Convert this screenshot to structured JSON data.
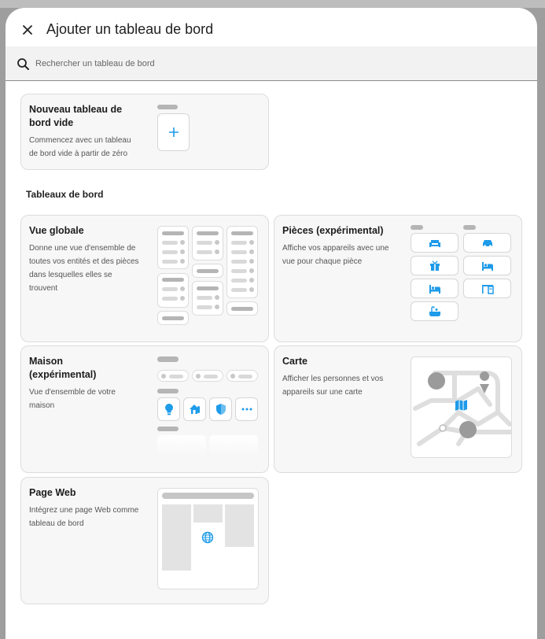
{
  "dialog": {
    "title": "Ajouter un tableau de bord",
    "close_icon": "close-icon"
  },
  "search": {
    "placeholder": "Rechercher un tableau de bord",
    "value": "",
    "icon": "search-icon"
  },
  "new_dashboard": {
    "title": "Nouveau tableau de bord vide",
    "description": "Commencez avec un tableau de bord vide à partir de zéro",
    "icon": "plus-icon"
  },
  "section": {
    "title": "Tableaux de bord"
  },
  "cards": {
    "overview": {
      "title": "Vue globale",
      "description": "Donne une vue d'ensemble de toutes vos entités et des pièces dans lesquelles elles se trouvent"
    },
    "rooms": {
      "title": "Pièces (expérimental)",
      "description": "Affiche vos appareils avec une vue pour chaque pièce",
      "icons": [
        "sofa-icon",
        "car-icon",
        "gift-icon",
        "bed-icon",
        "bed-icon",
        "desk-icon",
        "bath-icon"
      ]
    },
    "home": {
      "title": "Maison (expérimental)",
      "description": "Vue d'ensemble de votre maison",
      "icons": [
        "lightbulb-icon",
        "home-thermometer-icon",
        "shield-icon",
        "more-icon"
      ]
    },
    "map": {
      "title": "Carte",
      "description": "Afficher les personnes et vos appareils sur une carte",
      "icon": "map-icon"
    },
    "webpage": {
      "title": "Page Web",
      "description": "Intégrez une page Web comme tableau de bord",
      "icon": "globe-icon"
    }
  },
  "colors": {
    "accent": "#1e9be9",
    "card_bg": "#f7f7f7",
    "card_border": "#dcdcdc",
    "placeholder_gray": "#b5b5b5"
  }
}
